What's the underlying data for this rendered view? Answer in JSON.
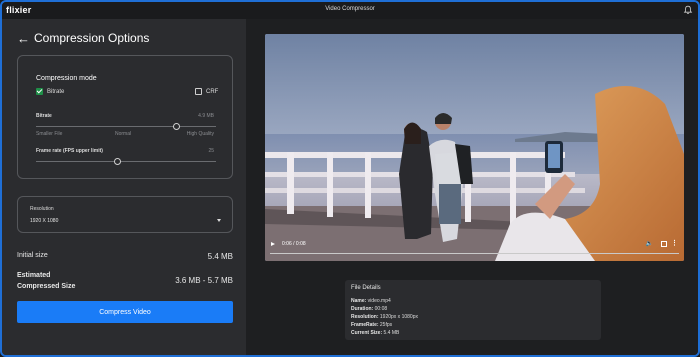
{
  "app": {
    "logo": "flixier",
    "window_title": "Video Compressor"
  },
  "header": {
    "back_title": "Compression Options"
  },
  "compression": {
    "title": "Compression mode",
    "modes": [
      {
        "label": "Bitrate",
        "checked": true
      },
      {
        "label": "CRF",
        "checked": false
      }
    ],
    "bitrate": {
      "label": "Bitrate",
      "value": "4.9 MB",
      "level": 0.78,
      "scale": [
        "Smaller File",
        "Normal",
        "High Quality"
      ]
    },
    "framerate": {
      "label": "Frame rate (FPS upper limit)",
      "value": "25",
      "level": 0.45
    }
  },
  "resolution": {
    "label": "Resolution",
    "value": "1920 X 1080"
  },
  "stats": {
    "initial_label": "Initial size",
    "initial_value": "5.4 MB",
    "estimated_label_1": "Estimated",
    "estimated_label_2": "Compressed Size",
    "estimated_value": "3.6 MB - 5.7 MB"
  },
  "compress_button": "Compress Video",
  "player": {
    "time": "0:06 / 0:08",
    "progress": 0.0
  },
  "file_details": {
    "title": "File Details",
    "lines": [
      {
        "key": "Name:",
        "value": " video.mp4"
      },
      {
        "key": "Duration:",
        "value": " 00:08"
      },
      {
        "key": "Resolution:",
        "value": " 1920px x 1080px"
      },
      {
        "key": "FrameRate:",
        "value": " 25fps"
      },
      {
        "key": "Current Size:",
        "value": " 5.4 MB"
      }
    ]
  },
  "colors": {
    "accent": "#1a7cf7",
    "check": "#1f8f48",
    "window_border": "#1f6fd6"
  },
  "icons": [
    "back-arrow-icon",
    "bell-icon",
    "check-icon",
    "play-icon",
    "volume-icon",
    "fullscreen-icon",
    "more-icon",
    "caret-down-icon"
  ]
}
